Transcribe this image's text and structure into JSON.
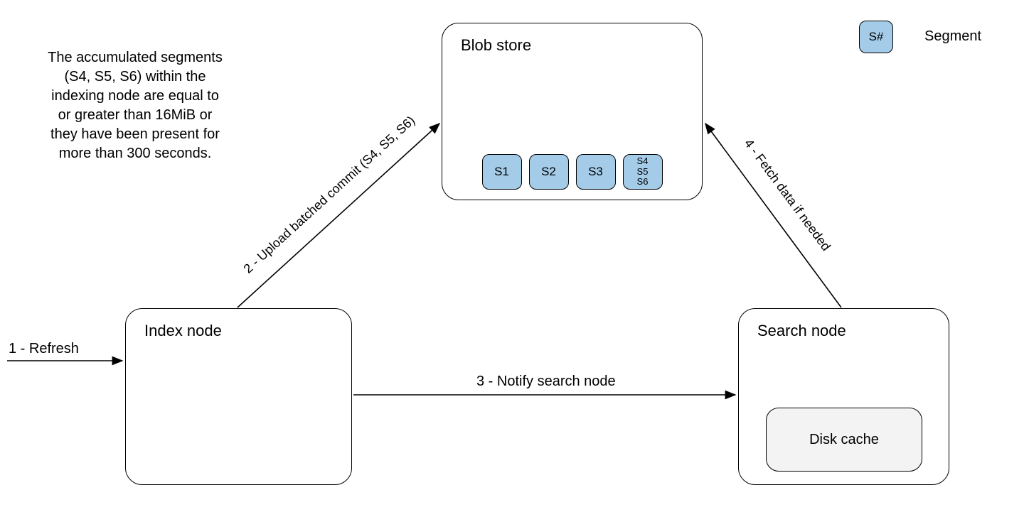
{
  "blob_store": {
    "title": "Blob store",
    "segments": [
      "S1",
      "S2",
      "S3"
    ],
    "stack": [
      "S4",
      "S5",
      "S6"
    ]
  },
  "index_node": {
    "title": "Index node"
  },
  "search_node": {
    "title": "Search node",
    "disk_cache": "Disk cache"
  },
  "description": "The accumulated segments (S4, S5, S6) within the indexing node are equal to or greater than 16MiB or they have been present for more than 300 seconds.",
  "edges": {
    "refresh": "1 - Refresh",
    "upload": "2 - Upload batched commit (S4, S5, S6)",
    "notify": "3 - Notify search node",
    "fetch": "4 - Fetch data if needed"
  },
  "legend": {
    "swatch": "S#",
    "label": "Segment"
  },
  "colors": {
    "segment_fill": "#a4cbe8",
    "disk_cache_fill": "#f3f3f3"
  }
}
